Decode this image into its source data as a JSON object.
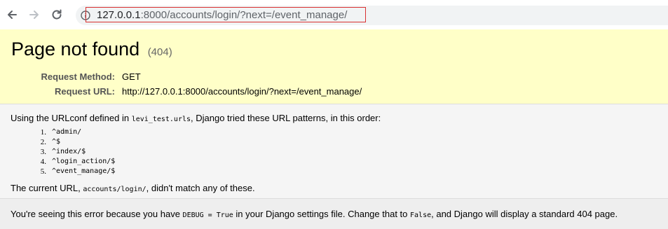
{
  "browser": {
    "back_icon": "arrow-left-icon",
    "forward_icon": "arrow-right-icon",
    "reload_icon": "reload-icon",
    "site_info_icon": "info-circle-icon",
    "url_host": "127.0.0.1",
    "url_rest": ":8000/accounts/login/?next=/event_manage/",
    "url_highlight_color": "#d93030"
  },
  "summary": {
    "title": "Page not found",
    "status_code": "(404)",
    "request_method_label": "Request Method:",
    "request_method": "GET",
    "request_url_label": "Request URL:",
    "request_url": "http://127.0.0.1:8000/accounts/login/?next=/event_manage/",
    "background": "#ffffc8"
  },
  "info": {
    "urlconf_prefix": "Using the URLconf defined in ",
    "urlconf_module": "levi_test.urls",
    "urlconf_suffix": ", Django tried these URL patterns, in this order:",
    "patterns": [
      {
        "num": "1.",
        "pattern": "^admin/"
      },
      {
        "num": "2.",
        "pattern": "^$"
      },
      {
        "num": "3.",
        "pattern": "^index/$"
      },
      {
        "num": "4.",
        "pattern": "^login_action/$"
      },
      {
        "num": "5.",
        "pattern": "^event_manage/$"
      }
    ],
    "current_prefix": "The current URL, ",
    "current_path": "accounts/login/",
    "current_suffix": ", didn't match any of these."
  },
  "explanation": {
    "part1": "You're seeing this error because you have ",
    "debug_code": "DEBUG = True",
    "part2": " in your Django settings file. Change that to ",
    "false_code": "False",
    "part3": ", and Django will display a standard 404 page."
  }
}
